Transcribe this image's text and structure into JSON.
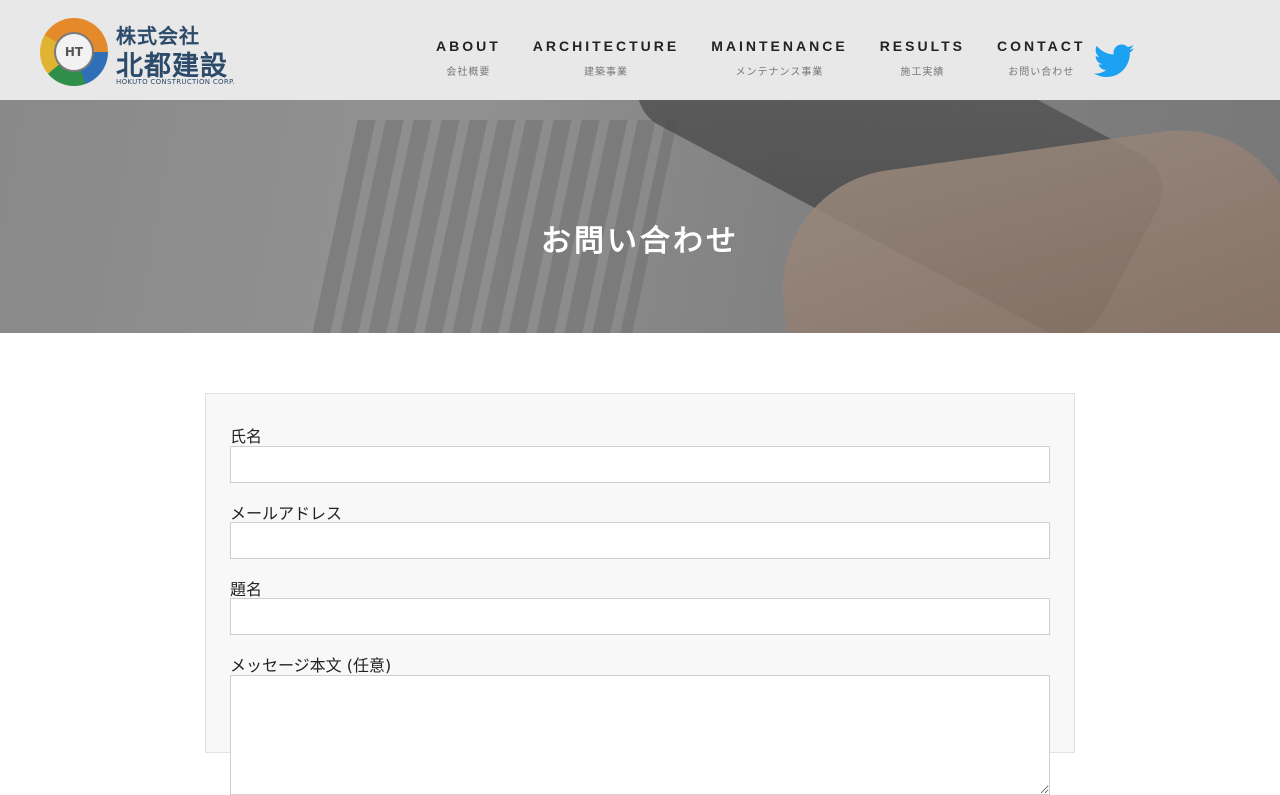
{
  "header": {
    "logo": {
      "company_type": "株式会社",
      "company_name": "北都建設",
      "english_name": "HOKUTO CONSTRUCTION CORP.",
      "mark_text": "HT"
    },
    "nav": [
      {
        "en": "ABOUT",
        "ja": "会社概要"
      },
      {
        "en": "ARCHITECTURE",
        "ja": "建築事業"
      },
      {
        "en": "MAINTENANCE",
        "ja": "メンテナンス事業"
      },
      {
        "en": "RESULTS",
        "ja": "施工実績"
      },
      {
        "en": "CONTACT",
        "ja": "お問い合わせ"
      }
    ],
    "social_icon": "twitter-icon",
    "twitter_color": "#1da1f2"
  },
  "hero": {
    "title": "お問い合わせ"
  },
  "form": {
    "fields": [
      {
        "label": "氏名",
        "value": ""
      },
      {
        "label": "メールアドレス",
        "value": ""
      },
      {
        "label": "題名",
        "value": ""
      },
      {
        "label": "メッセージ本文 (任意)",
        "value": ""
      }
    ]
  }
}
